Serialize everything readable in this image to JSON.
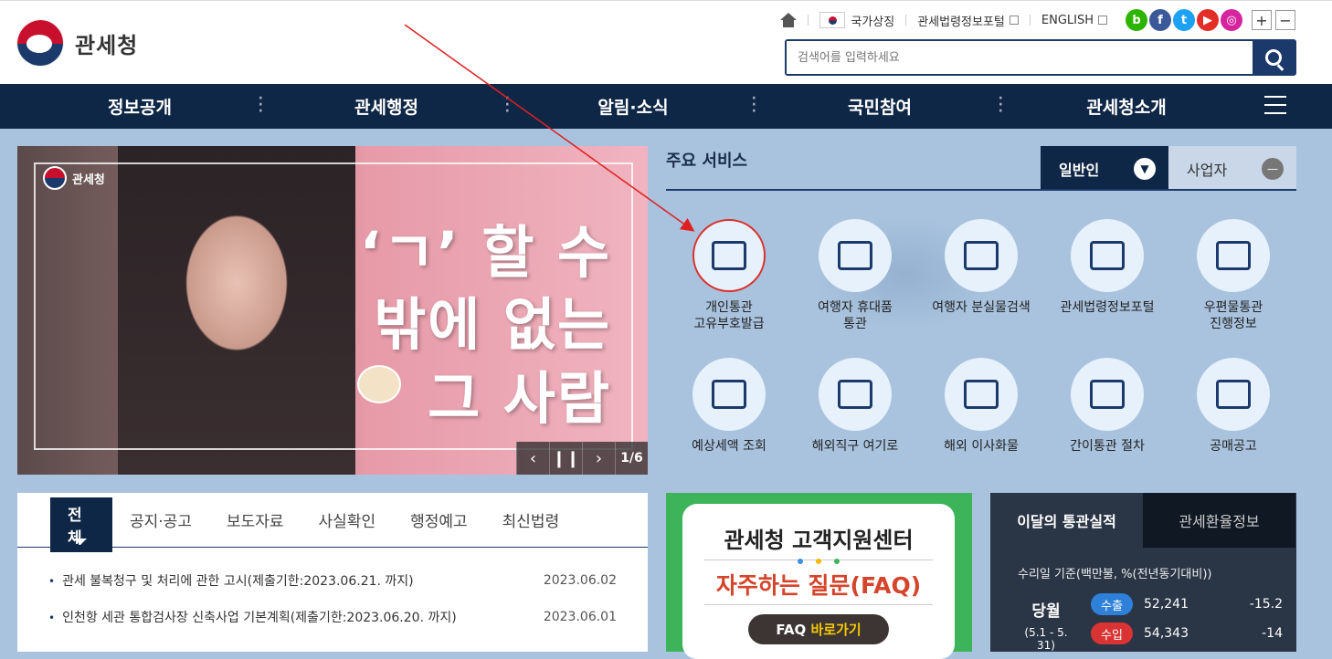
{
  "site": {
    "logo_text": "관세청"
  },
  "utility": {
    "national_symbol": "국가상징",
    "law_portal": "관세법령정보포털",
    "english": "ENGLISH",
    "sns": [
      {
        "name": "blog-icon",
        "glyph": "b",
        "color": "#2db400"
      },
      {
        "name": "facebook-icon",
        "glyph": "f",
        "color": "#3b5998"
      },
      {
        "name": "twitter-icon",
        "glyph": "t",
        "color": "#1da1f2"
      },
      {
        "name": "youtube-icon",
        "glyph": "▶",
        "color": "#e52d27"
      },
      {
        "name": "instagram-icon",
        "glyph": "◎",
        "color": "#d6249f"
      }
    ],
    "zoom_in": "+",
    "zoom_out": "−"
  },
  "search": {
    "placeholder": "검색어를 입력하세요"
  },
  "gnb": {
    "items": [
      "정보공개",
      "관세행정",
      "알림·소식",
      "국민참여",
      "관세청소개"
    ]
  },
  "banner": {
    "logo": "관세청",
    "line1": "‘ㄱ’ 할 수",
    "line2": "밖에 없는",
    "line3": "그 사람",
    "pager": "1/6"
  },
  "services": {
    "title": "주요 서비스",
    "tabs": [
      "일반인",
      "사업자"
    ],
    "items": [
      "개인통관\n고유부호발급",
      "여행자 휴대품\n통관",
      "여행자 분실물검색",
      "관세법령정보포털",
      "우편물통관\n진행정보",
      "예상세액 조회",
      "해외직구 여기로",
      "해외 이사화물",
      "간이통관 절차",
      "공매공고"
    ]
  },
  "news": {
    "tabs": [
      "전체",
      "공지·공고",
      "보도자료",
      "사실확인",
      "행정예고",
      "최신법령"
    ],
    "rows": [
      {
        "title": "관세 불복청구 및 처리에 관한 고시(제출기한:2023.06.21. 까지)",
        "date": "2023.06.02"
      },
      {
        "title": "인천항 세관 통합검사장 신축사업 기본계획(제출기한:2023.06.20. 까지)",
        "date": "2023.06.01"
      }
    ]
  },
  "faq": {
    "title": "관세청 고객지원센터",
    "subtitle": "자주하는 질문(FAQ)",
    "button_prefix": "FAQ ",
    "button_highlight": "바로가기"
  },
  "stats": {
    "tab_active": "이달의 통관실적",
    "tab_inactive": "관세환율정보",
    "basis": "수리일 기준(백만불, %(전년동기대비))",
    "month_label": "당월",
    "period": "(5.1 - 5. 31)",
    "export_label": "수출",
    "export_value": "52,241",
    "export_rate": "-15.2",
    "import_label": "수입",
    "import_value": "54,343",
    "import_rate": "-14",
    "export_color": "#2f80d8",
    "import_color": "#d93333"
  }
}
